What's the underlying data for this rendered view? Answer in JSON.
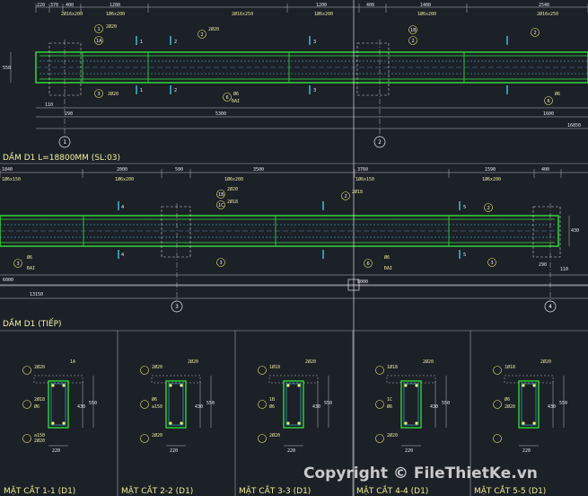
{
  "titles": {
    "beam1": "DẦM D1 L=18800MM (SL:03)",
    "beam2": "DẦM D1 (TIẾP)"
  },
  "beam1": {
    "top_dims": [
      "220",
      "370",
      "400",
      "1200",
      "1200",
      "400",
      "1400",
      "2540"
    ],
    "rebar_top": [
      "2Ø16x200",
      "1Ø6x200",
      "2Ø16x250",
      "1Ø6x200",
      "1Ø6x200",
      "2Ø16x250"
    ],
    "bottom_dims": [
      "110",
      "290",
      "5300",
      "1600",
      "16850"
    ],
    "height_label": "550",
    "callouts": [
      "1",
      "2",
      "1A",
      "1B",
      "3",
      "4",
      "6"
    ],
    "section_marks": [
      "1",
      "1",
      "2",
      "2",
      "3",
      "3"
    ],
    "notes": [
      "2Ø20",
      "2Ø20",
      "2Ø20",
      "Ø6",
      "ĐAI"
    ],
    "axes": [
      "1",
      "2"
    ]
  },
  "beam2": {
    "top_dims": [
      "1840",
      "2000",
      "500",
      "3500",
      "3760",
      "1590",
      "400"
    ],
    "rebar_top": [
      "1Ø6x150",
      "1Ø6x200",
      "1Ø6x200",
      "1Ø6x150",
      "1Ø6x200"
    ],
    "bottom_dims": [
      "6000",
      "13150",
      "8000",
      "290",
      "110"
    ],
    "height_label": "430",
    "callouts": [
      "1B",
      "1C",
      "2",
      "3",
      "5",
      "6"
    ],
    "section_marks": [
      "4",
      "4",
      "5",
      "5"
    ],
    "notes": [
      "2Ø20",
      "2Ø18",
      "2Ø18",
      "Ø6",
      "ĐAI"
    ],
    "axes": [
      "3",
      "4"
    ]
  },
  "sections": [
    {
      "caption": "MẶT CẮT 1-1 (D1)",
      "labels": [
        "2Ø20",
        "1A",
        "2Ø18",
        "Ø6",
        "a150",
        "2Ø20"
      ],
      "dims": [
        "220",
        "430",
        "550"
      ]
    },
    {
      "caption": "MẶT CẮT 2-2 (D1)",
      "labels": [
        "2Ø20",
        "2Ø20",
        "Ø6",
        "a150",
        "2Ø20"
      ],
      "dims": [
        "220",
        "430",
        "550"
      ]
    },
    {
      "caption": "MẶT CẮT 3-3 (D1)",
      "labels": [
        "1Ø18",
        "2Ø20",
        "1B",
        "Ø6",
        "2Ø20"
      ],
      "dims": [
        "220",
        "430",
        "550"
      ]
    },
    {
      "caption": "MẶT CẮT 4-4 (D1)",
      "labels": [
        "1Ø18",
        "2Ø20",
        "1C",
        "Ø6",
        "2Ø20"
      ],
      "dims": [
        "220",
        "430",
        "550"
      ]
    },
    {
      "caption": "MẶT CẮT 5-5 (D1)",
      "labels": [
        "1Ø18",
        "2Ø20",
        "Ø6",
        "2Ø20"
      ],
      "dims": [
        "220",
        "430",
        "550"
      ]
    }
  ],
  "watermark": "Copyright © FileThietKe.vn",
  "colors": {
    "background": "#1c2027",
    "concrete": "#31e63a",
    "rebar": "#3cc8e6",
    "text": "#e8e8e8",
    "title": "#f2f2a0",
    "callout": "#f2f26a"
  }
}
